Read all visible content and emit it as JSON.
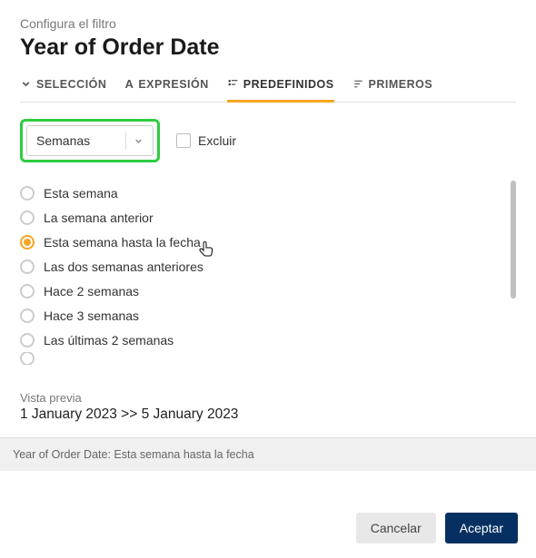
{
  "header": {
    "subtitle": "Configura el filtro",
    "title": "Year of Order Date"
  },
  "tabs": [
    {
      "label": "SELECCIÓN"
    },
    {
      "label": "EXPRESIÓN"
    },
    {
      "label": "PREDEFINIDOS"
    },
    {
      "label": "PRIMEROS"
    }
  ],
  "dropdown": {
    "value": "Semanas"
  },
  "exclude": {
    "label": "Excluir"
  },
  "options": [
    "Esta semana",
    "La semana anterior",
    "Esta semana hasta la fecha",
    "Las dos semanas anteriores",
    "Hace 2 semanas",
    "Hace 3 semanas",
    "Las últimas 2 semanas"
  ],
  "preview": {
    "label": "Vista previa",
    "value": "1 January 2023 >> 5 January 2023"
  },
  "summary": "Year of Order Date: Esta semana hasta la fecha",
  "footer": {
    "cancel": "Cancelar",
    "accept": "Aceptar"
  }
}
